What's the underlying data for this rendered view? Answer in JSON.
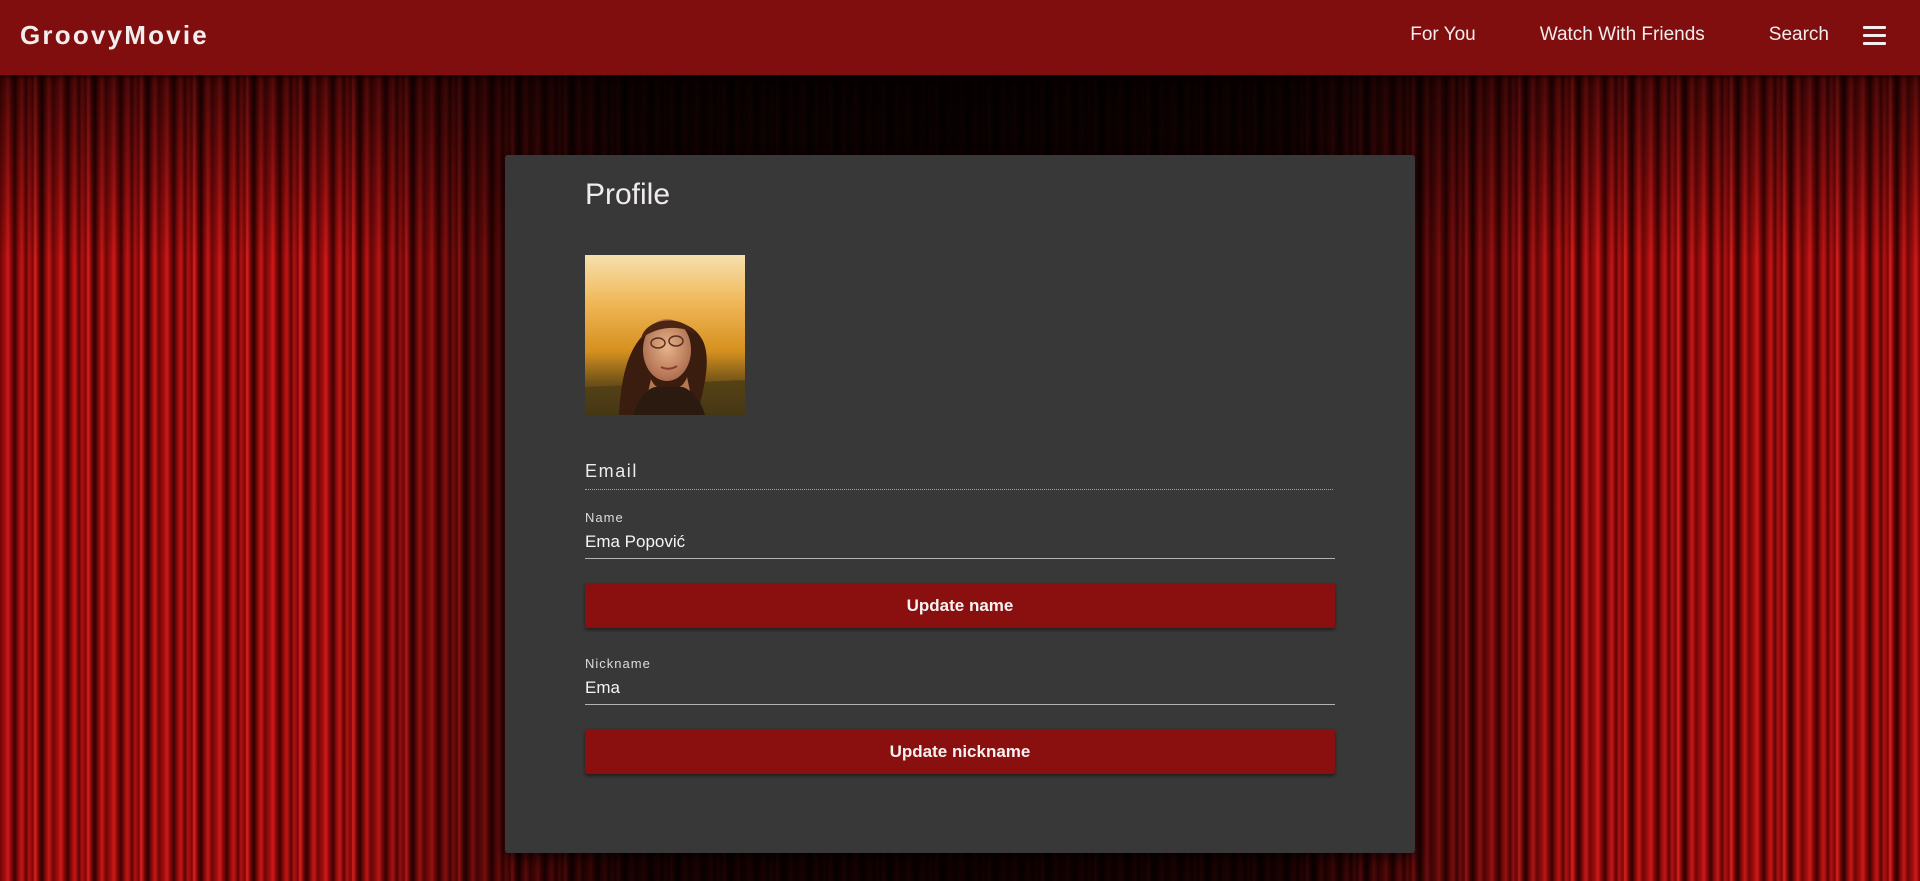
{
  "app": {
    "brand": "GroovyMovie"
  },
  "nav": {
    "links": [
      "For You",
      "Watch With Friends",
      "Search"
    ],
    "menu_icon": "hamburger-menu-icon"
  },
  "profile": {
    "title": "Profile",
    "avatar_alt": "profile photo",
    "email_label": "Email",
    "name_field": {
      "label": "Name",
      "value": "Ema Popović"
    },
    "update_name_label": "Update name",
    "nickname_field": {
      "label": "Nickname",
      "value": "Ema"
    },
    "update_nickname_label": "Update nickname"
  },
  "colors": {
    "app_bar": "#800e0e",
    "button": "#8a0f0f",
    "card": "#383838"
  }
}
